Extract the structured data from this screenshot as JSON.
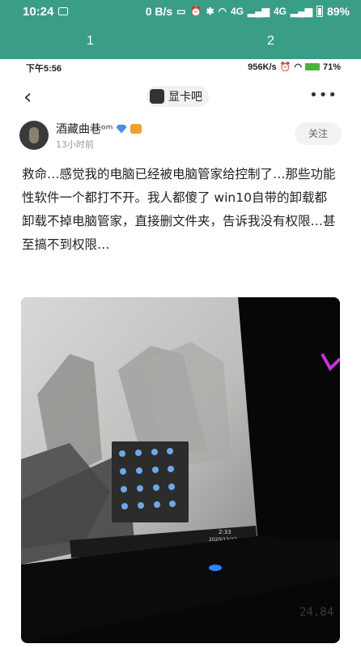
{
  "status_bar": {
    "time": "10:24",
    "net_speed": "0 B/s",
    "signal_1": "4G",
    "signal_2": "4G",
    "battery": "89%"
  },
  "tabs": [
    "1",
    "2"
  ],
  "screenshot": {
    "status_bar": {
      "time": "下午5:56",
      "net_speed": "956K/s",
      "battery": "71%"
    },
    "forum": {
      "name": "显卡吧"
    },
    "post": {
      "author": "酒藏曲巷ᵒᵐ",
      "time": "13小时前",
      "follow_label": "关注",
      "text": "救命…感觉我的电脑已经被电脑管家给控制了…那些功能性软件一个都打不开。我人都傻了 win10自带的卸载都卸载不掉电脑管家，直接删文件夹，告诉我没有权限…甚至搞不到权限…"
    },
    "photo": {
      "taskbar_time": "2:33",
      "taskbar_date": "2020/12/27",
      "device_readout": "24.84"
    }
  }
}
